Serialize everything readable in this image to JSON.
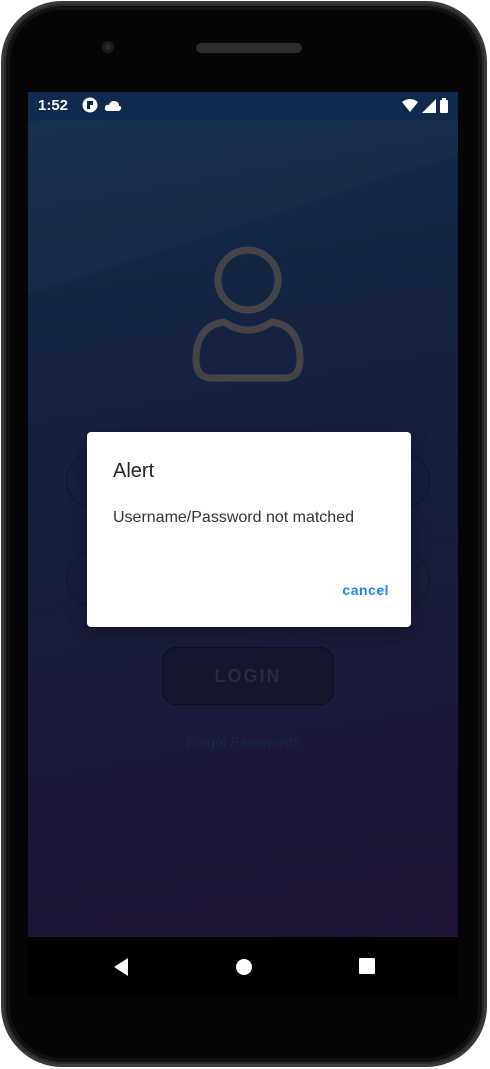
{
  "status_bar": {
    "time": "1:52",
    "left_icons": [
      "notification-app-icon",
      "cloud-icon"
    ],
    "right_icons": [
      "wifi-icon",
      "signal-icon",
      "battery-icon"
    ]
  },
  "login": {
    "avatar_icon": "user-icon",
    "username_placeholder": "",
    "password_placeholder": "",
    "login_label": "LOGIN",
    "forgot_label": "Forgot Password?"
  },
  "dialog": {
    "title": "Alert",
    "message": "Username/Password not matched",
    "cancel_label": "cancel"
  },
  "nav": {
    "icons": [
      "back-icon",
      "home-icon",
      "recents-icon"
    ]
  },
  "colors": {
    "dialog_accent": "#1e88e5",
    "background_top": "#1d4a7c",
    "background_bottom": "#321f57",
    "status_bar": "#0e2a4f"
  }
}
